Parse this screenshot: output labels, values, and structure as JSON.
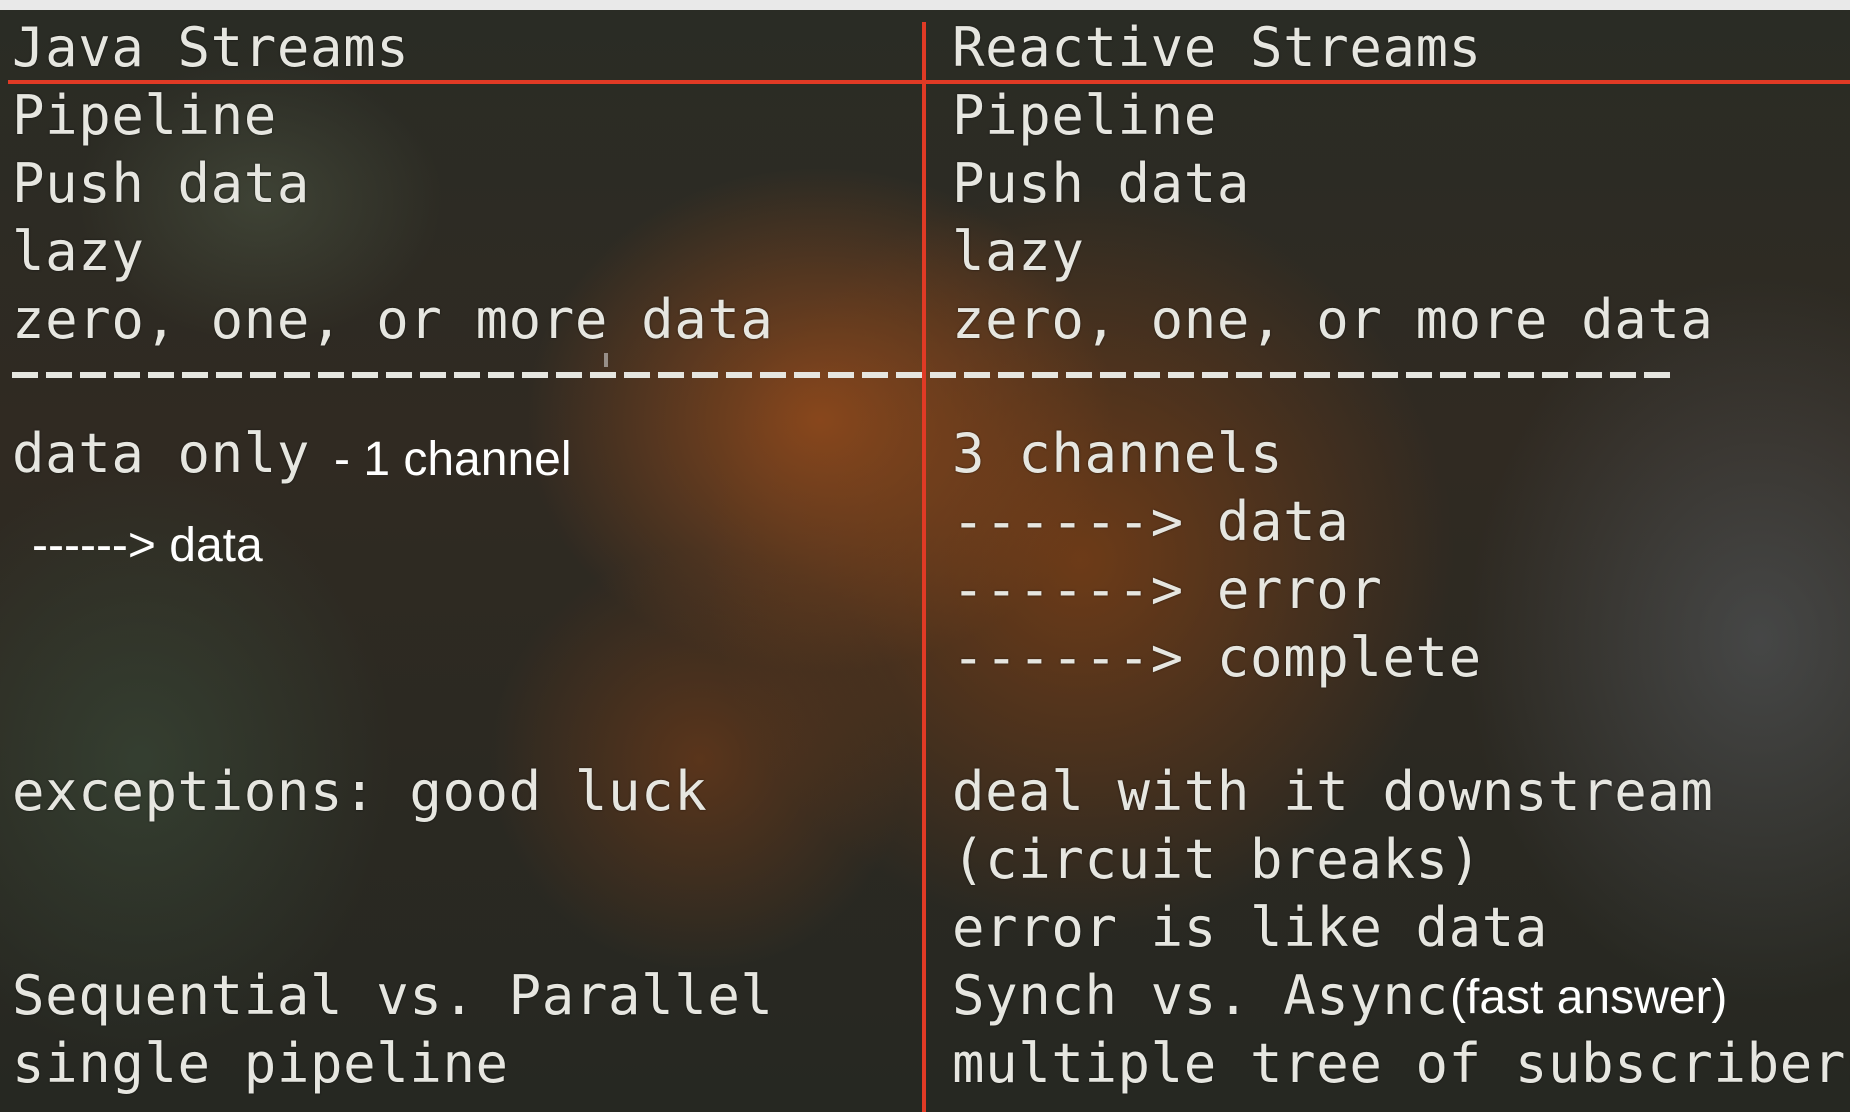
{
  "left": {
    "header": "Java Streams",
    "rows": [
      "Pipeline",
      "Push data",
      "lazy",
      "zero, one, or more data"
    ],
    "data_only": "data only",
    "channel_note": "- 1 channel",
    "arrow_data": "------> data",
    "exceptions": "exceptions: good luck",
    "sequential": "Sequential vs. Parallel",
    "single": "single pipeline"
  },
  "right": {
    "header": "Reactive Streams",
    "rows": [
      "Pipeline",
      "Push data",
      "lazy",
      "zero, one, or more data"
    ],
    "channels": "3 channels",
    "arrow_data": "------> data",
    "arrow_error": "------> error",
    "arrow_complete": "------> complete",
    "deal": "deal with it downstream",
    "circuit": "(circuit breaks)",
    "error_like": "error is like data",
    "synch": "Synch vs. Async",
    "fast_answer": "(fast answer)",
    "multiple": "multiple tree of subscribers"
  },
  "colors": {
    "divider": "#e03a25",
    "text": "#e6e6e0"
  }
}
